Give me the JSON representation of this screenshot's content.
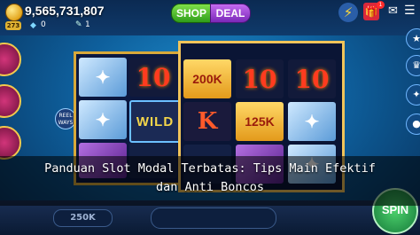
{
  "header": {
    "balance": "9,565,731,807",
    "level": "273",
    "gems": "0",
    "tickets": "1",
    "shop_label": "SHOP",
    "deal_label": "DEAL",
    "notification_count": "1"
  },
  "side": {
    "left_promos": [
      "",
      "",
      ""
    ],
    "reel_ways_label": "REEL WAYS"
  },
  "reels": {
    "left": [
      [
        "fish",
        "10"
      ],
      [
        "fish",
        "WILD"
      ],
      [
        "purple",
        ""
      ]
    ],
    "right": [
      [
        "200K",
        "10",
        "10"
      ],
      [
        "K",
        "125K",
        "fish"
      ],
      [
        "",
        "",
        ""
      ]
    ]
  },
  "bottom": {
    "bet": "250K",
    "win": "",
    "spin_label": "SPIN"
  },
  "overlay": {
    "title_line1": "Panduan Slot Modal Terbatas: Tips Main Efektif",
    "title_line2": "dan Anti Boncos"
  },
  "colors": {
    "shop": "#2f9d1a",
    "deal": "#7a28b8",
    "frame_gold": "#f1c45a",
    "ten_red": "#ff3b1f"
  }
}
